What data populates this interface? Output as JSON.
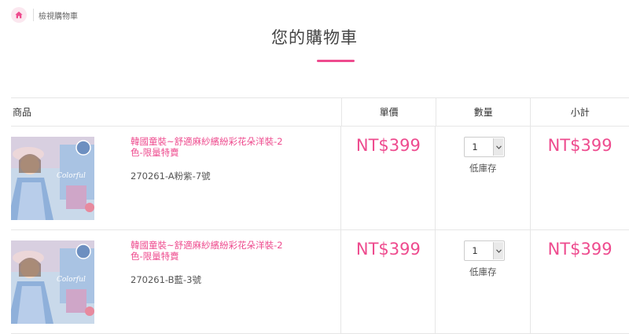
{
  "breadcrumb": {
    "home_icon": "home-icon",
    "current": "檢視購物車"
  },
  "page_title": "您的購物車",
  "accent_color": "#ee4b8e",
  "table": {
    "headers": {
      "product": "商品",
      "price": "單價",
      "quantity": "數量",
      "subtotal": "小計"
    },
    "items": [
      {
        "name": "韓國童裝~舒適麻紗繽紛彩花朵洋裝-2色-限量特賣",
        "variant": "270261-A粉紫-7號",
        "price": "NT$399",
        "quantity": "1",
        "stock_note": "低庫存",
        "subtotal": "NT$399"
      },
      {
        "name": "韓國童裝~舒適麻紗繽紛彩花朵洋裝-2色-限量特賣",
        "variant": "270261-B藍-3號",
        "price": "NT$399",
        "quantity": "1",
        "stock_note": "低庫存",
        "subtotal": "NT$399"
      }
    ]
  }
}
